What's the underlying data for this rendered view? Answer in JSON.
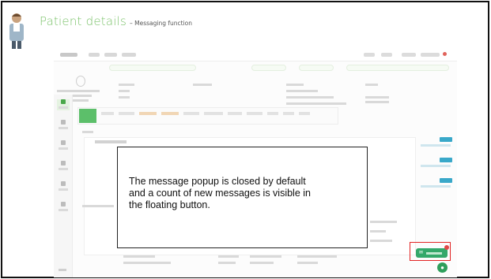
{
  "slide": {
    "title": "Patient details",
    "subtitle": "– Messaging function"
  },
  "callout": {
    "text": "The message popup is closed by default\nand a count of new messages is visible in\nthe floating button."
  },
  "colors": {
    "title_green": "#7cc36b",
    "app_green": "#33a86a",
    "highlight_red": "#e22424",
    "badge_red": "#e14848",
    "vital_blue": "#39a8c9"
  },
  "icons": {
    "floating_button": "message-icon",
    "help": "chat-icon",
    "presenter": "doctor-avatar-icon"
  }
}
